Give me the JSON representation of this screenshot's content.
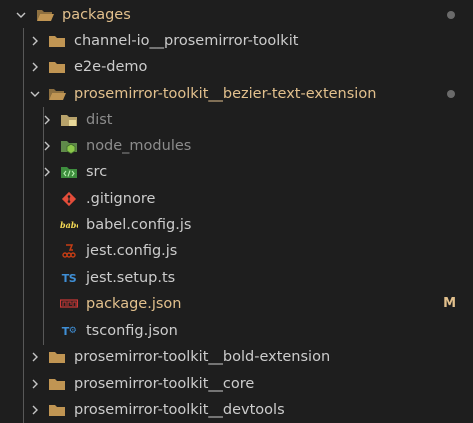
{
  "colors": {
    "background": "#1e1e1e",
    "text_default": "#cccccc",
    "text_modified": "#e2c08d",
    "text_ignored": "#8c8c8c",
    "folder": "#c09553",
    "folder_dim": "#8e7040",
    "modified_dot": "#6b6b6b",
    "badge": "#e2c08d"
  },
  "explorer": {
    "root": {
      "label": "packages",
      "icon": "folder-open-icon",
      "expanded": true,
      "modified": true
    },
    "items": [
      {
        "label": "channel-io__prosemirror-toolkit",
        "icon": "folder-icon",
        "expanded": false
      },
      {
        "label": "e2e-demo",
        "icon": "folder-icon",
        "expanded": false
      },
      {
        "label": "prosemirror-toolkit__bezier-text-extension",
        "icon": "folder-open-icon",
        "expanded": true,
        "modified": true,
        "children": [
          {
            "label": "dist",
            "icon": "dist-folder-icon",
            "type": "folder"
          },
          {
            "label": "node_modules",
            "icon": "node-modules-folder-icon",
            "type": "folder"
          },
          {
            "label": "src",
            "icon": "src-folder-icon",
            "type": "folder"
          },
          {
            "label": ".gitignore",
            "icon": "git-icon",
            "type": "file"
          },
          {
            "label": "babel.config.js",
            "icon": "babel-icon",
            "type": "file"
          },
          {
            "label": "jest.config.js",
            "icon": "jest-icon",
            "type": "file"
          },
          {
            "label": "jest.setup.ts",
            "icon": "typescript-icon",
            "type": "file"
          },
          {
            "label": "package.json",
            "icon": "npm-icon",
            "type": "file",
            "badge": "M"
          },
          {
            "label": "tsconfig.json",
            "icon": "tsconfig-icon",
            "type": "file"
          }
        ]
      },
      {
        "label": "prosemirror-toolkit__bold-extension",
        "icon": "folder-icon",
        "expanded": false
      },
      {
        "label": "prosemirror-toolkit__core",
        "icon": "folder-icon",
        "expanded": false
      },
      {
        "label": "prosemirror-toolkit__devtools",
        "icon": "folder-icon",
        "expanded": false
      }
    ]
  }
}
